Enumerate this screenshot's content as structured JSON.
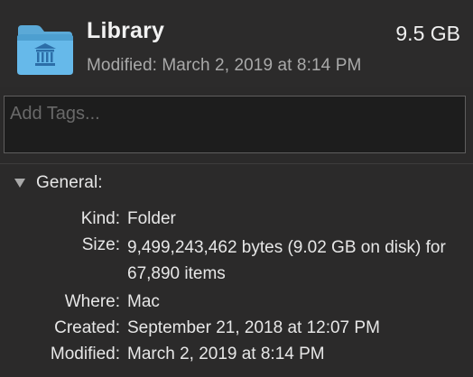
{
  "header": {
    "title": "Library",
    "size": "9.5 GB",
    "modified": "Modified: March 2, 2019 at 8:14 PM",
    "icon": "library-folder-icon"
  },
  "tags": {
    "placeholder": "Add Tags..."
  },
  "general": {
    "label": "General:",
    "disclosure_icon": "triangle-down-icon",
    "fields": {
      "kind": {
        "label": "Kind:",
        "value": "Folder"
      },
      "size": {
        "label": "Size:",
        "value": "9,499,243,462 bytes (9.02 GB on disk) for 67,890 items"
      },
      "where": {
        "label": "Where:",
        "value": "Mac"
      },
      "created": {
        "label": "Created:",
        "value": "September 21, 2018 at 12:07 PM"
      },
      "modified": {
        "label": "Modified:",
        "value": "March 2, 2019 at 8:14 PM"
      }
    }
  },
  "colors": {
    "background": "#2b2a2a",
    "folder_blue": "#5aaee0",
    "folder_dark_blue": "#2c6ea8",
    "tag_field": "#1d1d1d"
  }
}
